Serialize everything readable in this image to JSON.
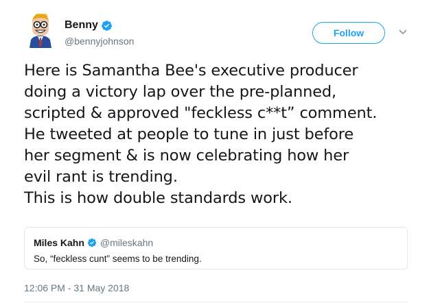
{
  "author": {
    "name": "Benny",
    "handle": "@bennyjohnson",
    "verified": true
  },
  "actions": {
    "follow_label": "Follow",
    "more_icon": "chevron-down-icon"
  },
  "tweet": {
    "lines": [
      "Here is Samantha Bee's executive producer",
      "doing a victory lap over the pre-planned,",
      "scripted & approved \"feckless c**t” comment.",
      "He tweeted at people to tune in just before",
      "her segment & is now celebrating how her",
      "evil rant is trending.",
      "This is how double standards work."
    ],
    "timestamp": "12:06 PM - 31 May 2018"
  },
  "quoted_tweet": {
    "name": "Miles Kahn",
    "handle": "@mileskahn",
    "verified": true,
    "text": "So, “feckless cunt” seems to be trending."
  },
  "colors": {
    "accent": "#1da1f2",
    "text": "#14171a",
    "muted": "#657786",
    "border": "#e1e8ed"
  }
}
